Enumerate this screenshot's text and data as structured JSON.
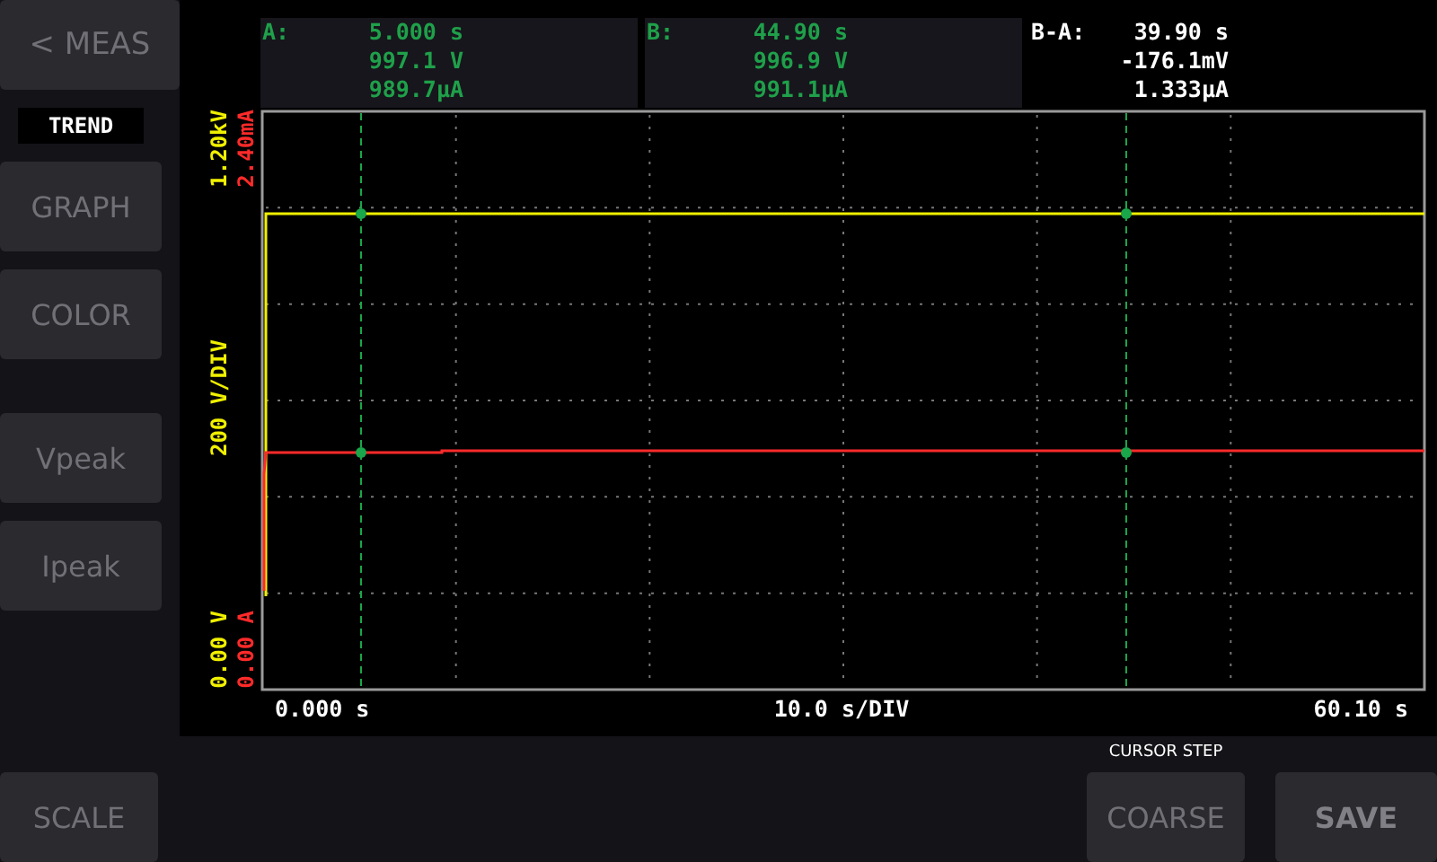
{
  "sidebar": {
    "back_button": {
      "arrow": "<",
      "label": "MEAS"
    },
    "mode_label": "TREND",
    "buttons": [
      {
        "label": "GRAPH"
      },
      {
        "label": "COLOR"
      },
      {
        "label": "Vpeak"
      },
      {
        "label": "Ipeak"
      }
    ]
  },
  "readouts": [
    {
      "kind": "cursor",
      "label": "A:",
      "lines": [
        "5.000 s",
        "997.1 V",
        "989.7µA"
      ]
    },
    {
      "kind": "cursor",
      "label": "B:",
      "lines": [
        "44.90 s",
        "996.9 V",
        "991.1µA"
      ]
    },
    {
      "kind": "delta",
      "label": "B-A:",
      "lines": [
        "39.90 s",
        "-176.1mV",
        "1.333µA"
      ]
    }
  ],
  "trend": {
    "voltage_axis": {
      "top": "1.20kV",
      "scale": "200 V/DIV",
      "bottom": "0.00 V"
    },
    "current_axis": {
      "top": "2.40mA",
      "bottom": "0.00 A"
    },
    "time_axis": {
      "start": "0.000 s",
      "scale": "10.0 s/DIV",
      "end": "60.10 s"
    }
  },
  "bottom_bar": {
    "scale_button": "SCALE",
    "cursor_step": {
      "caption": "CURSOR STEP",
      "button": "COARSE"
    },
    "save_button": "SAVE"
  }
}
